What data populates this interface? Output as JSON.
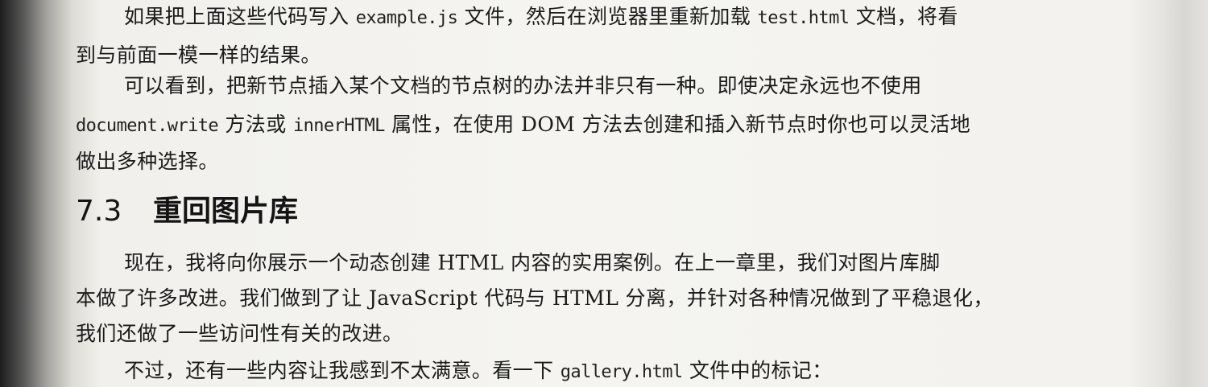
{
  "paragraph1": {
    "line1_a": "如果把上面这些代码写入",
    "line1_code1": "example.js",
    "line1_b": "文件，然后在浏览器里重新加载",
    "line1_code2": "test.html",
    "line1_c": "文档，将看",
    "line2": "到与前面一模一样的结果。"
  },
  "paragraph2": {
    "line1": "可以看到，把新节点插入某个文档的节点树的办法并非只有一种。即使决定永远也不使用",
    "line2_code1": "document.write",
    "line2_a": "方法或",
    "line2_code2": "innerHTML",
    "line2_b": "属性，在使用 DOM 方法去创建和插入新节点时你也可以灵活地",
    "line3": "做出多种选择。"
  },
  "section": {
    "number": "7.3",
    "title": "重回图片库"
  },
  "paragraph3": {
    "line1": "现在，我将向你展示一个动态创建 HTML 内容的实用案例。在上一章里，我们对图片库脚",
    "line2": "本做了许多改进。我们做到了让 JavaScript 代码与 HTML 分离，并针对各种情况做到了平稳退化，",
    "line3": "我们还做了一些访问性有关的改进。"
  },
  "paragraph4": {
    "line1_a": "不过，还有一些内容让我感到不太满意。看一下",
    "line1_code": "gallery.html",
    "line1_b": "文件中的标记："
  }
}
